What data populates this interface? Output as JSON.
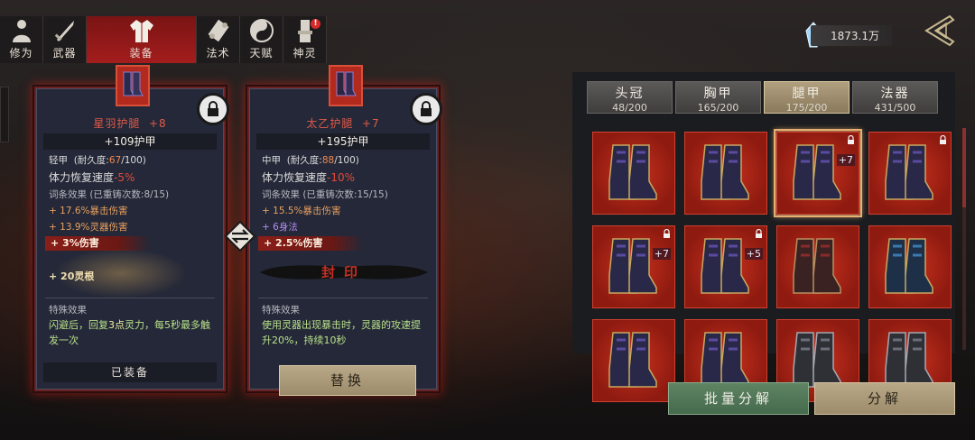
{
  "tabs": [
    {
      "label": "修为",
      "icon": "cultivation-figure-icon"
    },
    {
      "label": "武器",
      "icon": "sword-icon"
    },
    {
      "label": "装备",
      "icon": "robe-icon",
      "active": true
    },
    {
      "label": "法术",
      "icon": "scroll-icon"
    },
    {
      "label": "天赋",
      "icon": "taiji-icon"
    },
    {
      "label": "神灵",
      "icon": "deity-statue-icon",
      "badge": "!"
    }
  ],
  "currency": {
    "amount": "1873.1万",
    "icon": "spirit-crystal-icon"
  },
  "equipped_item": {
    "name": "星羽护腿",
    "level": "+8",
    "armor": "+109护甲",
    "type": "轻甲",
    "durability_label": "(耐久度:",
    "durability_current": "67",
    "durability_max": "/100)",
    "stamina_label": "体力恢复速度",
    "stamina_value": "-5%",
    "affix_header": "词条效果  (已重铸次数:8/15)",
    "affixes": [
      "+ 17.6%暴击伤害",
      "+ 13.9%灵器伤害"
    ],
    "highlight_affix": "+ 3%伤害",
    "special_affix": "+ 20灵根",
    "special_header": "特殊效果",
    "special_desc_pre": "闪避后，回复",
    "special_desc_num": "3点",
    "special_desc_post": "灵力，每5秒最多触发一次",
    "equipped_label": "已装备"
  },
  "compare_item": {
    "name": "太乙护腿",
    "level": "+7",
    "armor": "+195护甲",
    "type": "中甲",
    "durability_label": "(耐久度:",
    "durability_current": "88",
    "durability_max": "/100)",
    "stamina_label": "体力恢复速度",
    "stamina_value": "-10%",
    "affix_header": "词条效果  (已重铸次数:15/15)",
    "affixes": [
      "+ 15.5%暴击伤害"
    ],
    "purple_affix": "+ 6身法",
    "highlight_affix": "+ 2.5%伤害",
    "seal_text": "封印",
    "special_header": "特殊效果",
    "special_desc": "使用灵器出现暴击时，灵器的攻速提升20%，持续10秒"
  },
  "replace_button": "替换",
  "categories": [
    {
      "title": "头冠",
      "count": "48/200"
    },
    {
      "title": "胸甲",
      "count": "165/200"
    },
    {
      "title": "腿甲",
      "count": "175/200",
      "active": true
    },
    {
      "title": "法器",
      "count": "431/500"
    }
  ],
  "inventory_slots": [
    {
      "level": "",
      "locked": false,
      "selected": false,
      "color": "purple"
    },
    {
      "level": "",
      "locked": false,
      "selected": false,
      "color": "purple"
    },
    {
      "level": "+7",
      "locked": true,
      "selected": true,
      "color": "purple"
    },
    {
      "level": "",
      "locked": true,
      "selected": false,
      "color": "purple"
    },
    {
      "level": "+7",
      "locked": true,
      "selected": false,
      "color": "purple"
    },
    {
      "level": "+5",
      "locked": true,
      "selected": false,
      "color": "purple"
    },
    {
      "level": "",
      "locked": false,
      "selected": false,
      "color": "red"
    },
    {
      "level": "",
      "locked": false,
      "selected": false,
      "color": "blue"
    },
    {
      "level": "",
      "locked": false,
      "selected": false,
      "color": "purple"
    },
    {
      "level": "",
      "locked": false,
      "selected": false,
      "color": "purple"
    },
    {
      "level": "",
      "locked": false,
      "selected": false,
      "color": "gray"
    },
    {
      "level": "",
      "locked": false,
      "selected": false,
      "color": "gray"
    }
  ],
  "bulk_dismantle_button": "批量分解",
  "dismantle_button": "分解"
}
